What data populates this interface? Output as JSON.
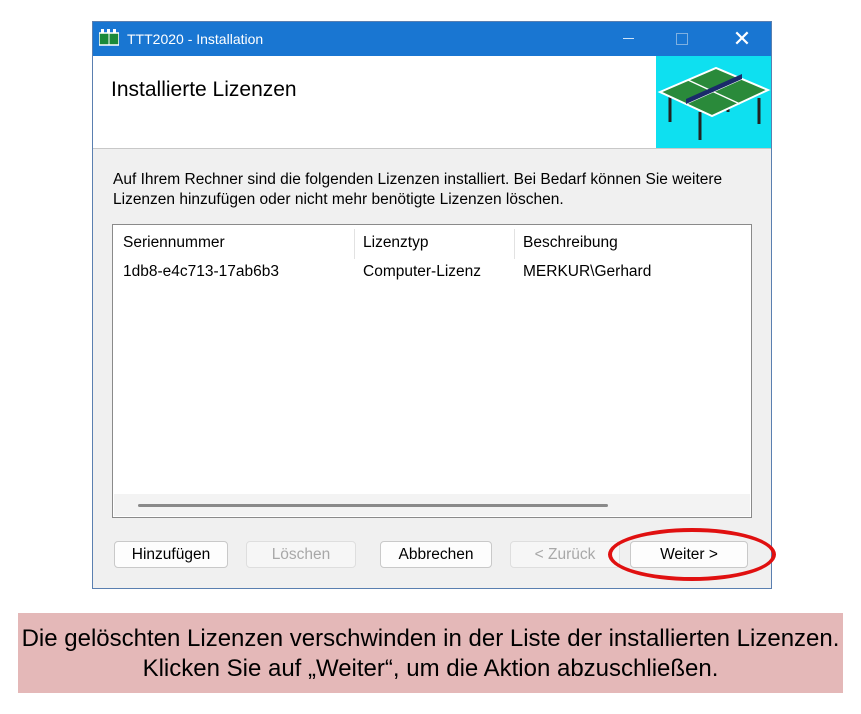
{
  "window": {
    "title": "TTT2020 - Installation",
    "minimize": "",
    "maximize": "",
    "close": "✕"
  },
  "header": {
    "title": "Installierte Lizenzen"
  },
  "description": "Auf Ihrem Rechner sind die folgenden Lizenzen installiert. Bei Bedarf können Sie weitere Lizenzen hinzufügen oder nicht mehr benötigte Lizenzen löschen.",
  "list": {
    "columns": [
      "Seriennummer",
      "Lizenztyp",
      "Beschreibung"
    ],
    "rows": [
      [
        "1db8-e4c713-17ab6b3",
        "Computer-Lizenz",
        "MERKUR\\Gerhard"
      ]
    ]
  },
  "buttons": {
    "add": "Hinzufügen",
    "delete": "Löschen",
    "cancel": "Abbrechen",
    "back": "< Zurück",
    "next": "Weiter >"
  },
  "caption": "Die gelöschten Lizenzen verschwinden in der Liste der installierten Lizenzen. Klicken Sie auf „Weiter“, um die Aktion abzuschließen.",
  "colors": {
    "titlebar": "#1976d2",
    "highlight": "#e01010",
    "caption_bg": "#e4b8b8",
    "header_image_bg": "#0ee0f0"
  },
  "icons": {
    "app": "ping-pong-table-icon",
    "header_image": "ping-pong-table-icon"
  }
}
